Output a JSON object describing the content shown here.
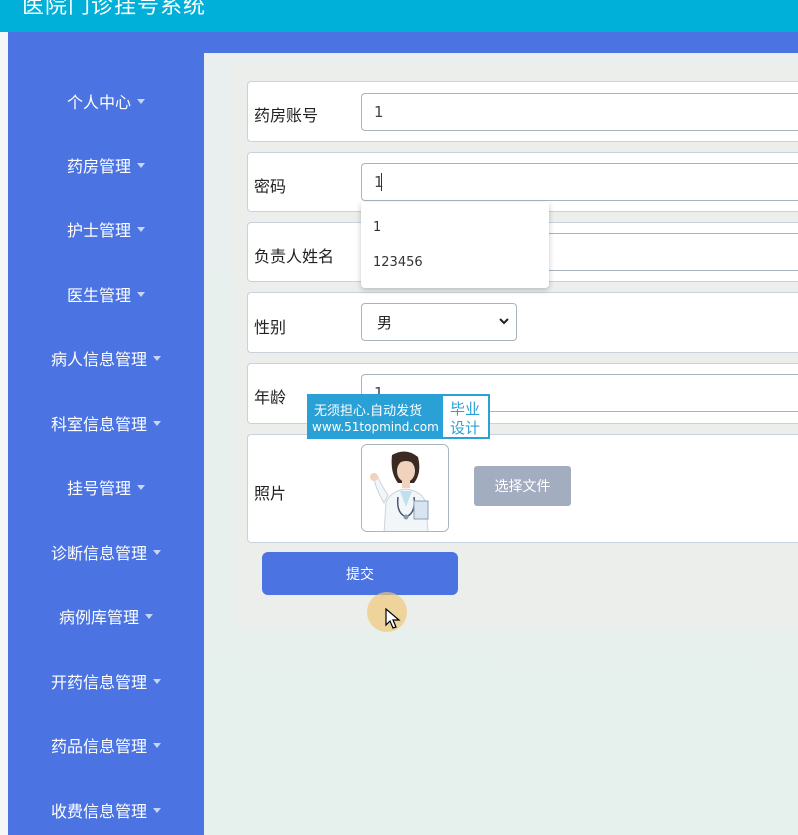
{
  "header": {
    "title": "医院门诊挂号系统"
  },
  "sidebar": {
    "items": [
      {
        "label": "个人中心"
      },
      {
        "label": "药房管理"
      },
      {
        "label": "护士管理"
      },
      {
        "label": "医生管理"
      },
      {
        "label": "病人信息管理"
      },
      {
        "label": "科室信息管理"
      },
      {
        "label": "挂号管理"
      },
      {
        "label": "诊断信息管理"
      },
      {
        "label": "病例库管理"
      },
      {
        "label": "开药信息管理"
      },
      {
        "label": "药品信息管理"
      },
      {
        "label": "收费信息管理"
      }
    ]
  },
  "form": {
    "account": {
      "label": "药房账号",
      "value": "1"
    },
    "password": {
      "label": "密码",
      "value": "1"
    },
    "manager": {
      "label": "负责人姓名",
      "value": ""
    },
    "gender": {
      "label": "性别",
      "value": "男"
    },
    "age": {
      "label": "年龄",
      "value": "1"
    },
    "photo": {
      "label": "照片",
      "button_label": "选择文件"
    },
    "submit_label": "提交"
  },
  "autocomplete": {
    "options": [
      "1",
      "123456"
    ]
  },
  "watermark": {
    "line1": "无须担心.自动发货",
    "line2": "www.51topmind.com",
    "right1": "毕业",
    "right2": "设计"
  },
  "colors": {
    "header": "#00b0d9",
    "sidebar": "#4b74e2",
    "button": "#4b74e2",
    "file_button": "#a3adc0"
  }
}
